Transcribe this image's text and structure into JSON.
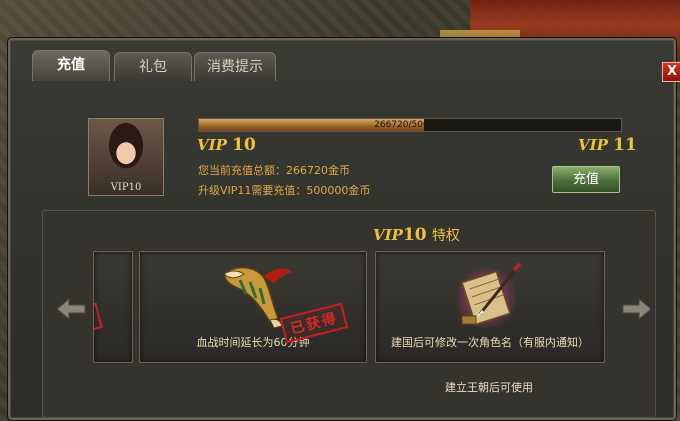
{
  "tabs": [
    {
      "label": "充值",
      "active": true
    },
    {
      "label": "礼包",
      "active": false
    },
    {
      "label": "消费提示",
      "active": false
    }
  ],
  "close_label": "X",
  "avatar": {
    "label": "VIP10"
  },
  "progress": {
    "text": "266720/500000",
    "current": 266720,
    "max": 500000
  },
  "vip": {
    "current_prefix": "VIP",
    "current_level": "10",
    "next_prefix": "VIP",
    "next_level": "11"
  },
  "info": {
    "total": "您当前充值总额：266720金币",
    "need": "升级VIP11需要充值：500000金币"
  },
  "recharge_button": "充值",
  "privilege": {
    "title_prefix": "VIP",
    "title_level": "10",
    "title_suffix": "特权",
    "cards": [
      {
        "caption": "血战时间延长为60分钟",
        "stamp": "已获得",
        "icon": "horn-icon"
      },
      {
        "caption": "建国后可修改一次角色名（有服内通知）",
        "icon": "scroll-brush-icon"
      }
    ],
    "partial_stamp": "得",
    "footer_note": "建立王朝后可使用"
  },
  "colors": {
    "gold": "#f0c23c",
    "info_text": "#e0a848",
    "stamp_red": "#c22020",
    "button_green": "#4c7038"
  }
}
